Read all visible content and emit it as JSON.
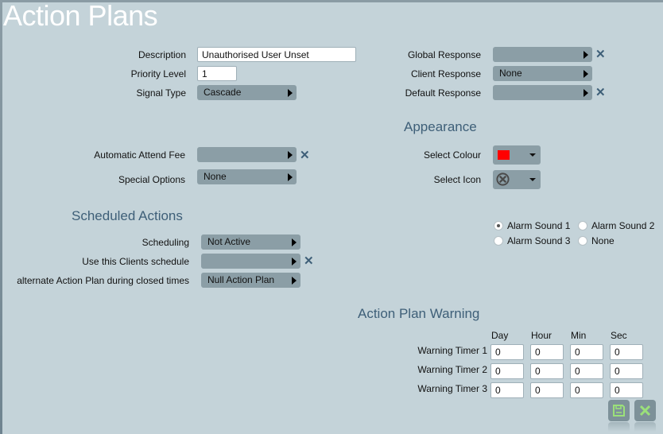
{
  "page": {
    "title": "Action Plans"
  },
  "general": {
    "description": {
      "label": "Description",
      "value": "Unauthorised User Unset"
    },
    "priority_level": {
      "label": "Priority Level",
      "value": "1"
    },
    "signal_type": {
      "label": "Signal Type",
      "value": "Cascade"
    }
  },
  "responses": {
    "global_response": {
      "label": "Global Response",
      "value": ""
    },
    "client_response": {
      "label": "Client Response",
      "value": "None"
    },
    "default_response": {
      "label": "Default Response",
      "value": ""
    }
  },
  "fees": {
    "automatic_attend_fee": {
      "label": "Automatic Attend Fee",
      "value": ""
    },
    "special_options": {
      "label": "Special Options",
      "value": "None"
    }
  },
  "appearance": {
    "title": "Appearance",
    "select_colour": {
      "label": "Select Colour",
      "value_color": "#ff0000"
    },
    "select_icon": {
      "label": "Select Icon",
      "value_icon": "circle-x-icon"
    }
  },
  "alarm_sounds": {
    "options": [
      "Alarm Sound 1",
      "Alarm Sound 2",
      "Alarm Sound 3",
      "None"
    ],
    "selected": "Alarm Sound 1"
  },
  "scheduled_actions": {
    "title": "Scheduled Actions",
    "scheduling": {
      "label": "Scheduling",
      "value": "Not Active"
    },
    "clients_schedule": {
      "label": "Use this Clients schedule",
      "value": ""
    },
    "alternate_plan": {
      "label": "alternate Action Plan during closed times",
      "value": "Null Action Plan"
    }
  },
  "warning": {
    "title": "Action Plan Warning",
    "columns": [
      "Day",
      "Hour",
      "Min",
      "Sec"
    ],
    "timers": [
      {
        "label": "Warning Timer 1",
        "values": [
          "0",
          "0",
          "0",
          "0"
        ]
      },
      {
        "label": "Warning Timer 2",
        "values": [
          "0",
          "0",
          "0",
          "0"
        ]
      },
      {
        "label": "Warning Timer 3",
        "values": [
          "0",
          "0",
          "0",
          "0"
        ]
      }
    ]
  },
  "footer": {
    "save_icon": "save-icon",
    "cancel_icon": "close-icon"
  },
  "colors": {
    "background": "#c4d3d9",
    "select_bg": "#8b9ea6",
    "accent": "#3e5f78",
    "button_icon": "#9be07a"
  }
}
